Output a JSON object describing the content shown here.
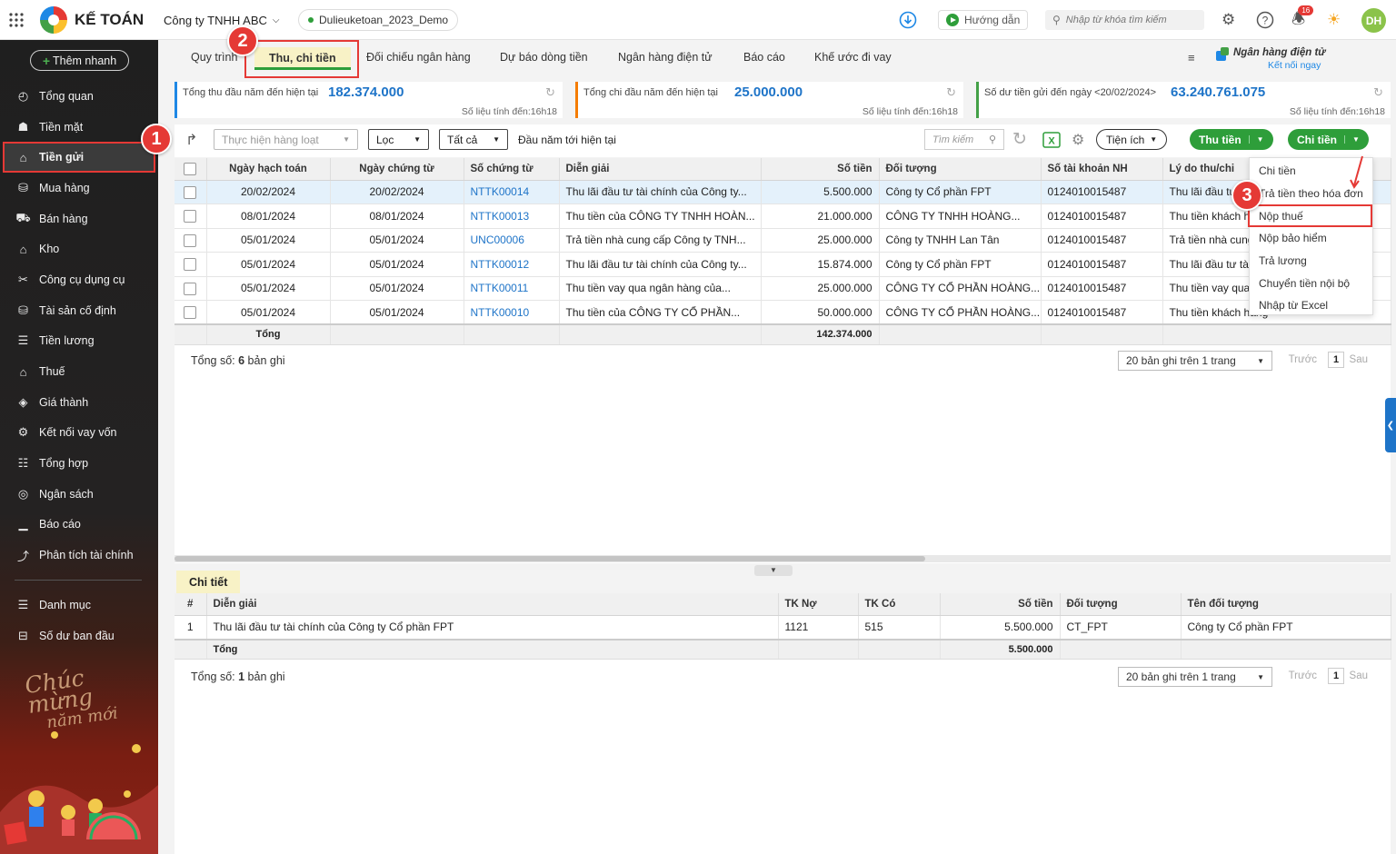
{
  "app": {
    "name": "KẾ TOÁN",
    "company": "Công ty TNHH ABC",
    "database": "Dulieuketoan_2023_Demo",
    "guide_label": "Hướng dẫn",
    "search_placeholder": "Nhập từ khóa tìm kiếm",
    "notification_count": "16",
    "user_initials": "DH"
  },
  "sidebar": {
    "quick_add": "Thêm nhanh",
    "items": [
      {
        "label": "Tổng quan",
        "icon": "dashboard-icon",
        "glyph": "◴"
      },
      {
        "label": "Tiền mặt",
        "icon": "cash-icon",
        "glyph": "☗"
      },
      {
        "label": "Tiền gửi",
        "icon": "bank-icon",
        "glyph": "⌂"
      },
      {
        "label": "Mua hàng",
        "icon": "bag-icon",
        "glyph": "⛁"
      },
      {
        "label": "Bán hàng",
        "icon": "cart-icon",
        "glyph": "⛟"
      },
      {
        "label": "Kho",
        "icon": "warehouse-icon",
        "glyph": "⌂"
      },
      {
        "label": "Công cụ dụng cụ",
        "icon": "tools-icon",
        "glyph": "✂"
      },
      {
        "label": "Tài sản cố định",
        "icon": "asset-icon",
        "glyph": "⛁"
      },
      {
        "label": "Tiền lương",
        "icon": "salary-icon",
        "glyph": "☰"
      },
      {
        "label": "Thuế",
        "icon": "tax-icon",
        "glyph": "⌂"
      },
      {
        "label": "Giá thành",
        "icon": "price-tag-icon",
        "glyph": "◈"
      },
      {
        "label": "Kết nối vay vốn",
        "icon": "loan-icon",
        "glyph": "⚙"
      },
      {
        "label": "Tổng hợp",
        "icon": "summary-icon",
        "glyph": "☷"
      },
      {
        "label": "Ngân sách",
        "icon": "budget-icon",
        "glyph": "◎"
      },
      {
        "label": "Báo cáo",
        "icon": "report-icon",
        "glyph": "▁"
      },
      {
        "label": "Phân tích tài chính",
        "icon": "analysis-icon",
        "glyph": "⤴"
      }
    ],
    "bottom_items": [
      {
        "label": "Danh mục",
        "icon": "list-icon",
        "glyph": "☰"
      },
      {
        "label": "Số dư ban đầu",
        "icon": "balance-icon",
        "glyph": "⊟"
      }
    ],
    "greeting_line1": "Chúc mừng",
    "greeting_line2": "năm mới"
  },
  "tabs": [
    "Quy trình",
    "Thu, chi tiền",
    "Đối chiếu ngân hàng",
    "Dự báo dòng tiền",
    "Ngân hàng điện tử",
    "Báo cáo",
    "Khế ước đi vay"
  ],
  "bank_link": {
    "title": "Ngân hàng điện tử",
    "subtitle": "Kết nối ngay"
  },
  "stats": [
    {
      "label": "Tổng thu đầu năm đến hiện tại",
      "value": "182.374.000",
      "timestamp": "Số liệu tính đến:16h18",
      "color": "#1e88e5"
    },
    {
      "label": "Tổng chi đầu năm đến hiện tại",
      "value": "25.000.000",
      "timestamp": "Số liệu tính đến:16h18",
      "color": "#f57c00"
    },
    {
      "label": "Số dư tiền gửi đến ngày <20/02/2024>",
      "value": "63.240.761.075",
      "timestamp": "Số liệu tính đến:16h18",
      "color": "#43a047"
    }
  ],
  "toolbar": {
    "batch": "Thực hiện hàng loạt",
    "filter": "Lọc",
    "all": "Tất cả",
    "period": "Đầu năm tới hiện tại",
    "search_placeholder": "Tìm kiếm",
    "utilities": "Tiện ích",
    "receive": "Thu tiền",
    "pay": "Chi tiền"
  },
  "grid": {
    "columns": [
      "Ngày hạch toán",
      "Ngày chứng từ",
      "Số chứng từ",
      "Diễn giải",
      "Số tiền",
      "Đối tượng",
      "Số tài khoản NH",
      "Lý do thu/chi"
    ],
    "rows": [
      [
        "20/02/2024",
        "20/02/2024",
        "NTTK00014",
        "Thu lãi đầu tư tài chính của Công ty...",
        "5.500.000",
        "Công ty Cổ phần FPT",
        "0124010015487",
        "Thu lãi đầu tư tài chính"
      ],
      [
        "08/01/2024",
        "08/01/2024",
        "NTTK00013",
        "Thu tiền của CÔNG TY TNHH HOÀN...",
        "21.000.000",
        "CÔNG TY TNHH HOÀNG...",
        "0124010015487",
        "Thu tiền khách hàng"
      ],
      [
        "05/01/2024",
        "05/01/2024",
        "UNC00006",
        "Trả tiền nhà cung cấp Công ty TNH...",
        "25.000.000",
        "Công ty TNHH Lan Tân",
        "0124010015487",
        "Trả tiền nhà cung cấp"
      ],
      [
        "05/01/2024",
        "05/01/2024",
        "NTTK00012",
        "Thu lãi đầu tư tài chính của Công ty...",
        "15.874.000",
        "Công ty Cổ phần FPT",
        "0124010015487",
        "Thu lãi đầu tư tài chính"
      ],
      [
        "05/01/2024",
        "05/01/2024",
        "NTTK00011",
        "Thu tiền vay qua ngân hàng của...",
        "25.000.000",
        "CÔNG TY CỔ PHẦN HOÀNG...",
        "0124010015487",
        "Thu tiền vay qua ngân hàng"
      ],
      [
        "05/01/2024",
        "05/01/2024",
        "NTTK00010",
        "Thu tiền của CÔNG TY CỔ PHẦN...",
        "50.000.000",
        "CÔNG TY CỔ PHẦN HOÀNG...",
        "0124010015487",
        "Thu tiền khách hàng"
      ]
    ],
    "total_label": "Tổng",
    "total_amount": "142.374.000",
    "count_prefix": "Tổng số: ",
    "count_value": "6",
    "count_suffix": " bản ghi",
    "page_size": "20 bản ghi trên 1 trang",
    "prev": "Trước",
    "page": "1",
    "next": "Sau"
  },
  "dropdown": [
    "Chi tiền",
    "Trả tiền theo hóa đơn",
    "Nộp thuế",
    "Nộp bảo hiểm",
    "Trả lương",
    "Chuyển tiền nội bộ",
    "Nhập từ Excel"
  ],
  "detail": {
    "tab": "Chi tiết",
    "columns": [
      "#",
      "Diễn giải",
      "TK Nợ",
      "TK Có",
      "Số tiền",
      "Đối tượng",
      "Tên đối tượng"
    ],
    "rows": [
      [
        "1",
        "Thu lãi đầu tư tài chính của Công ty Cổ phần FPT",
        "1121",
        "515",
        "5.500.000",
        "CT_FPT",
        "Công ty Cổ phần FPT"
      ]
    ],
    "total_label": "Tổng",
    "total_amount": "5.500.000",
    "count_prefix": "Tổng số: ",
    "count_value": "1",
    "count_suffix": " bản ghi",
    "page_size": "20 bản ghi trên 1 trang",
    "prev": "Trước",
    "page": "1",
    "next": "Sau"
  },
  "callouts": [
    "1",
    "2",
    "3"
  ],
  "colors": {
    "accent_green": "#2e9e3a",
    "highlight_red": "#e53935",
    "link_blue": "#1e74c8"
  }
}
